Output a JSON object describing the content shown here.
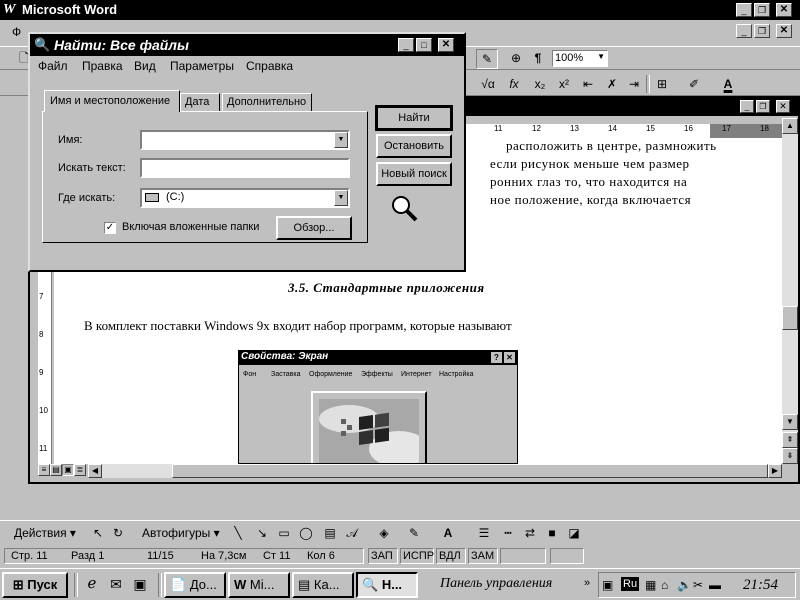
{
  "word": {
    "title": "Microsoft Word",
    "menu_partial": "Ф",
    "zoom": "100%",
    "doc_text": {
      "line1": "расположить в центре, размножить",
      "line2": "если рисунок меньше чем размер",
      "line3": "ронних глаз то, что находится на",
      "line4": "ное положение, когда включается",
      "heading": "3.5. Стандартные приложения",
      "para": "В комплект поставки Windows 9x входит набор программ, которые называют"
    },
    "ruler_numbers": [
      "11",
      "12",
      "13",
      "14",
      "15",
      "16",
      "17",
      "18"
    ],
    "vruler_numbers": [
      "7",
      "8",
      "9",
      "10",
      "11"
    ],
    "drawing_toolbar": {
      "actions": "Действия",
      "autoshapes": "Автофигуры"
    },
    "status": {
      "page": "Стр. 11",
      "section": "Разд 1",
      "pages": "11/15",
      "at": "На 7,3см",
      "line": "Ст 11",
      "col": "Кол 6",
      "rec": "ЗАП",
      "trk": "ИСПР",
      "ext": "ВДЛ",
      "ovr": "ЗАМ"
    }
  },
  "find_dialog": {
    "title": "Найти: Все файлы",
    "menu": [
      "Файл",
      "Правка",
      "Вид",
      "Параметры",
      "Справка"
    ],
    "tabs": [
      "Имя и местоположение",
      "Дата",
      "Дополнительно"
    ],
    "name_label": "Имя:",
    "text_label": "Искать текст:",
    "lookin_label": "Где искать:",
    "lookin_value": "(C:)",
    "subfolders_label": "Включая вложенные папки",
    "browse_button": "Обзор...",
    "find_button": "Найти",
    "stop_button": "Остановить",
    "new_button": "Новый поиск"
  },
  "props_dialog": {
    "title": "Свойства: Экран",
    "tabs": [
      "Фон",
      "Заставка",
      "Оформление",
      "Эффекты",
      "Интернет",
      "Настройка"
    ]
  },
  "taskbar": {
    "start": "Пуск",
    "tasks": [
      "До...",
      "Mi...",
      "Ка...",
      "Н..."
    ],
    "panel": "Панель управления",
    "lang": "Ru",
    "time": "21:54"
  }
}
